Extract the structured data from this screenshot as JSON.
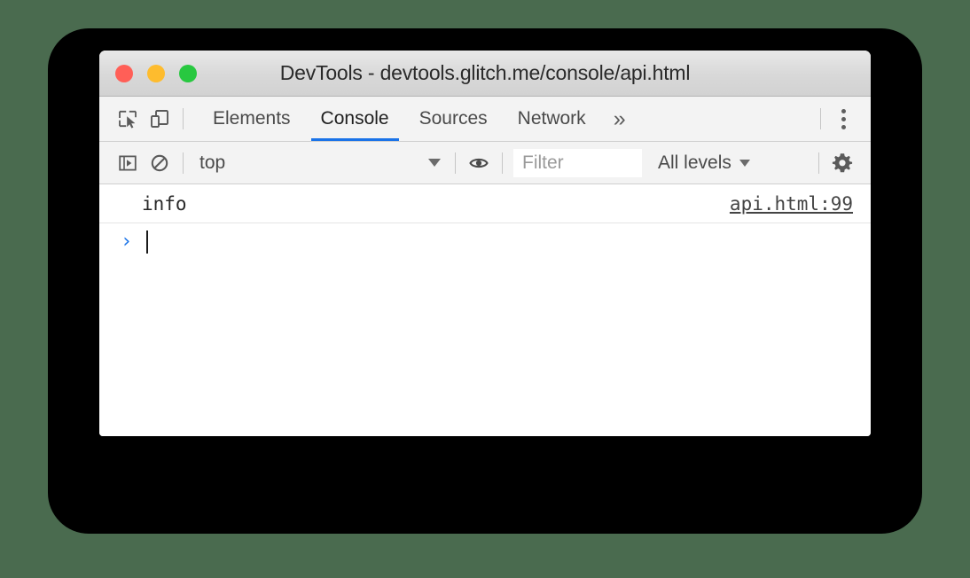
{
  "window": {
    "title": "DevTools - devtools.glitch.me/console/api.html",
    "traffic_lights": [
      {
        "name": "close",
        "color": "#ff5f57"
      },
      {
        "name": "minimize",
        "color": "#febc2e"
      },
      {
        "name": "maximize",
        "color": "#28c840"
      }
    ]
  },
  "devtools": {
    "left_icons": [
      {
        "name": "inspect-element-icon",
        "label": "Inspect element"
      },
      {
        "name": "device-toolbar-icon",
        "label": "Toggle device toolbar"
      }
    ],
    "tabs": [
      {
        "label": "Elements",
        "active": false
      },
      {
        "label": "Console",
        "active": true
      },
      {
        "label": "Sources",
        "active": false
      },
      {
        "label": "Network",
        "active": false
      }
    ],
    "more_tabs_label": "»",
    "main_menu_icon": "kebab-menu-icon",
    "active_tab_accent": "#1a73e8"
  },
  "console_toolbar": {
    "sidebar_toggle_icon": "console-sidebar-icon",
    "clear_console_icon": "clear-console-icon",
    "context_selector": {
      "value": "top"
    },
    "live_expression_icon": "eye-icon",
    "filter": {
      "value": "",
      "placeholder": "Filter"
    },
    "levels": {
      "value": "All levels"
    },
    "settings_icon": "gear-icon"
  },
  "console": {
    "messages": [
      {
        "text": "info",
        "source": "api.html:99"
      }
    ],
    "prompt": {
      "chevron": "›",
      "input_value": ""
    }
  }
}
